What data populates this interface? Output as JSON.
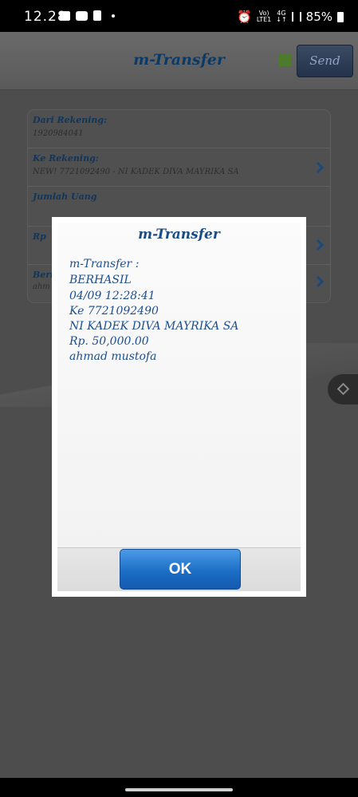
{
  "status_bar": {
    "time": "12.28",
    "network_top": "Vo)",
    "network_bottom": "LTE1",
    "gen_top": "4G",
    "gen_bottom": "↓↑",
    "battery": "85%"
  },
  "app": {
    "title": "m-Transfer",
    "send_label": "Send",
    "status_color": "#4e7a2b"
  },
  "form": {
    "from_account": {
      "label": "Dari Rekening:",
      "value": "1920984041"
    },
    "to_account": {
      "label": "Ke Rekening:",
      "value": "NEW! 7721092490 - NI KADEK DIVA MAYRIKA SA"
    },
    "amount": {
      "label": "Jumlah Uang"
    },
    "currency": {
      "label": "Rp"
    },
    "note": {
      "label": "Beri",
      "value": "ahm"
    }
  },
  "dialog": {
    "title": "m-Transfer",
    "lines": [
      "m-Transfer :",
      "BERHASIL",
      "04/09 12:28:41",
      "Ke 7721092490",
      "NI KADEK DIVA MAYRIKA SA",
      "Rp. 50,000.00",
      "ahmad mustofa"
    ],
    "ok_label": "OK"
  }
}
